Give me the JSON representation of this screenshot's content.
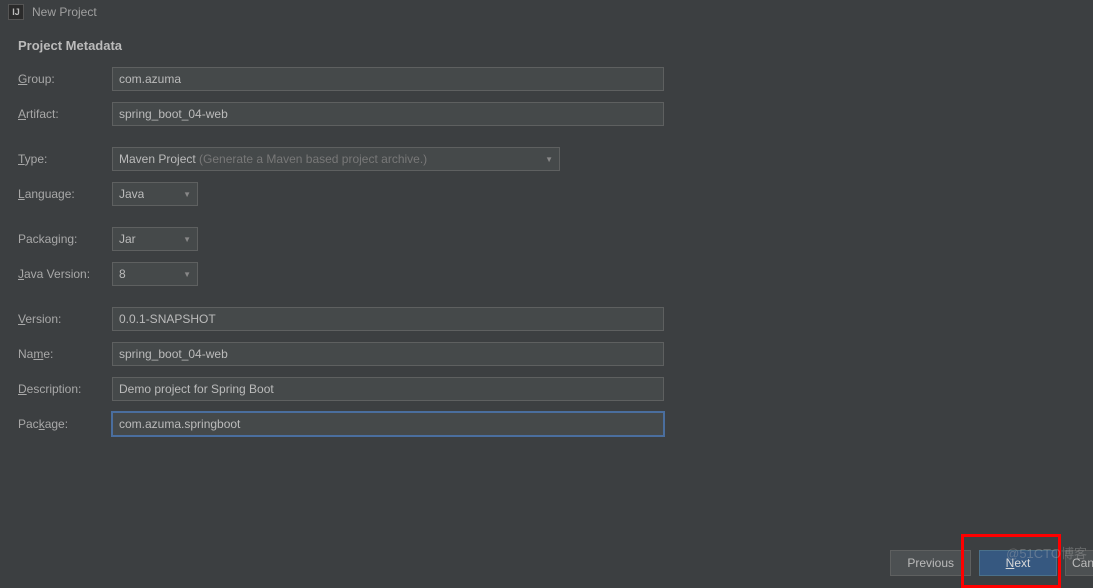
{
  "window": {
    "title": "New Project"
  },
  "section": {
    "title": "Project Metadata"
  },
  "labels": {
    "group": "Group:",
    "artifact": "Artifact:",
    "type": "Type:",
    "language": "Language:",
    "packaging": "Packaging:",
    "javaVersion": "Java Version:",
    "version": "Version:",
    "name": "Name:",
    "description": "Description:",
    "package": "Package:"
  },
  "fields": {
    "group": "com.azuma",
    "artifact": "spring_boot_04-web",
    "type": {
      "value": "Maven Project",
      "hint": "(Generate a Maven based project archive.)"
    },
    "language": "Java",
    "packaging": "Jar",
    "javaVersion": "8",
    "version": "0.0.1-SNAPSHOT",
    "name": "spring_boot_04-web",
    "description": "Demo project for Spring Boot",
    "package": "com.azuma.springboot"
  },
  "buttons": {
    "previous": "Previous",
    "next": "Next",
    "cancel": "Cancel"
  },
  "watermark": "@51CTO博客"
}
